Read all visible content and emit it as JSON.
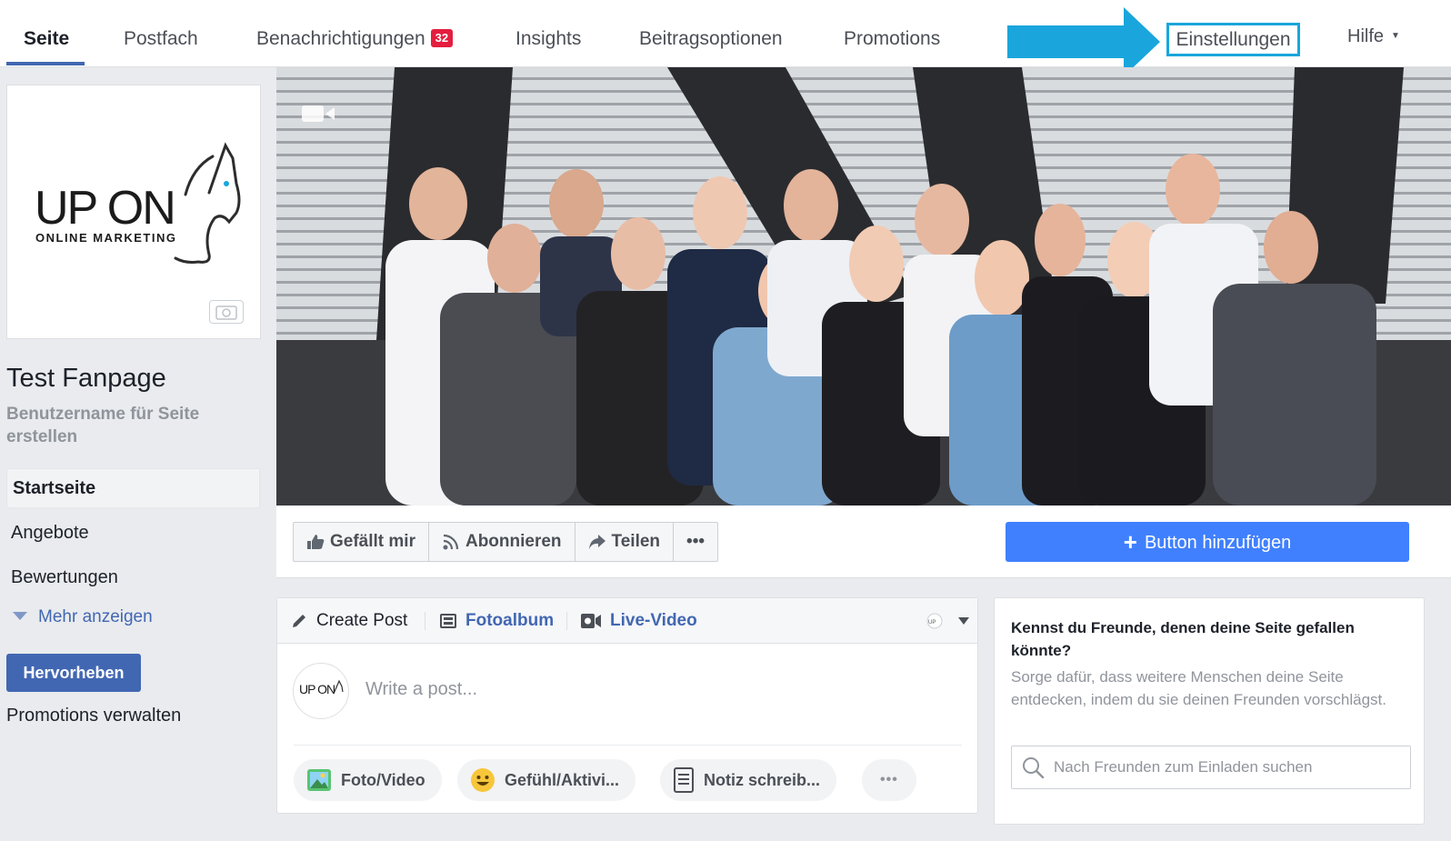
{
  "nav": {
    "tabs": [
      {
        "label": "Seite"
      },
      {
        "label": "Postfach"
      },
      {
        "label": "Benachrichtigungen",
        "badge": "32"
      },
      {
        "label": "Insights"
      },
      {
        "label": "Beitragsoptionen"
      },
      {
        "label": "Promotions"
      }
    ],
    "settings": "Einstellungen",
    "help": "Hilfe",
    "arrow_color": "#1aa6dc"
  },
  "sidebar": {
    "logo_main": "UP ON",
    "logo_sub": "ONLINE MARKETING",
    "page_name": "Test Fanpage",
    "username_link": "Benutzername für Seite erstellen",
    "items": [
      {
        "label": "Startseite",
        "active": true
      },
      {
        "label": "Angebote"
      },
      {
        "label": "Bewertungen"
      }
    ],
    "more": "Mehr anzeigen",
    "promote_button": "Hervorheben",
    "promotions_manage": "Promotions verwalten"
  },
  "cover": {
    "icon": "video-camera-icon"
  },
  "actions": {
    "like": "Gefällt mir",
    "follow": "Abonnieren",
    "share": "Teilen",
    "more": "•••",
    "add_button": "Button hinzufügen"
  },
  "composer": {
    "tabs": [
      {
        "label": "Create Post",
        "icon": "pencil-icon"
      },
      {
        "label": "Fotoalbum",
        "icon": "album-icon"
      },
      {
        "label": "Live-Video",
        "icon": "video-icon"
      }
    ],
    "avatar_text": "UP ON",
    "placeholder": "Write a post...",
    "pills": [
      {
        "label": "Foto/Video",
        "icon": "photo-icon"
      },
      {
        "label": "Gefühl/Aktivi...",
        "icon": "smiley-icon"
      },
      {
        "label": "Notiz schreib...",
        "icon": "note-icon"
      },
      {
        "label": "•••",
        "icon": "more-icon"
      }
    ]
  },
  "invite": {
    "title": "Kennst du Freunde, denen deine Seite gefallen könnte?",
    "text": "Sorge dafür, dass weitere Menschen deine Seite entdecken, indem du sie deinen Freunden vorschlägst.",
    "search_placeholder": "Nach Freunden zum Einladen suchen"
  },
  "colors": {
    "brand_blue": "#4267b2",
    "cta_blue": "#4080ff",
    "badge_red": "#e41e3f"
  }
}
